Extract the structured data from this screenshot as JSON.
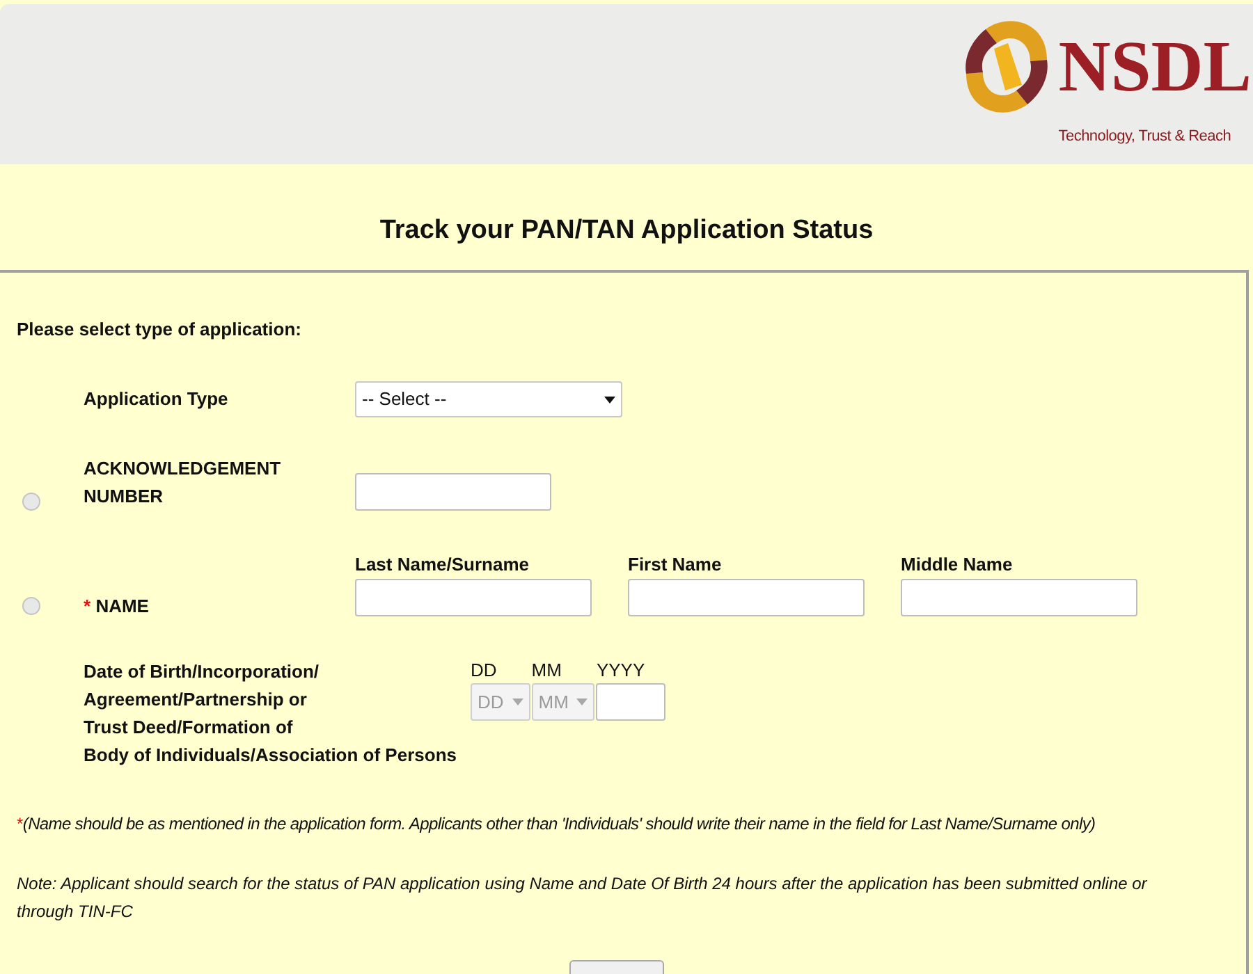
{
  "header": {
    "logo": {
      "wordmark": "NSDL",
      "tagline": "Technology, Trust & Reach"
    }
  },
  "title": "Track your PAN/TAN Application Status",
  "form": {
    "prompt": "Please select type of application:",
    "application_type": {
      "label": "Application Type",
      "value": "-- Select --"
    },
    "options": [
      {
        "kind": "acknowledgement",
        "selected": false,
        "label": "ACKNOWLEDGEMENT NUMBER"
      },
      {
        "kind": "name",
        "selected": false,
        "mark": "*",
        "label": "NAME",
        "fields": [
          {
            "label": "Last Name/Surname"
          },
          {
            "label": "First Name"
          },
          {
            "label": "Middle Name"
          }
        ]
      }
    ],
    "date_of_birth": {
      "label_lines": [
        "Date of Birth/Incorporation/",
        "Agreement/Partnership or",
        "Trust Deed/Formation of",
        "Body of Individuals/Association of Persons"
      ],
      "fields": [
        {
          "kind": "select",
          "label": "DD",
          "value": "DD",
          "disabled": true
        },
        {
          "kind": "select",
          "label": "MM",
          "value": "MM",
          "disabled": true
        },
        {
          "kind": "input",
          "label": "YYYY"
        }
      ]
    },
    "footnote": {
      "mark": "*",
      "text": "(Name should be as mentioned in the application form. Applicants other than 'Individuals' should write their name in the field for Last Name/Surname only)"
    },
    "note": "Note: Applicant should search for the status of PAN application using Name and Date Of Birth 24 hours after the application has been submitted online or through TIN-FC"
  }
}
